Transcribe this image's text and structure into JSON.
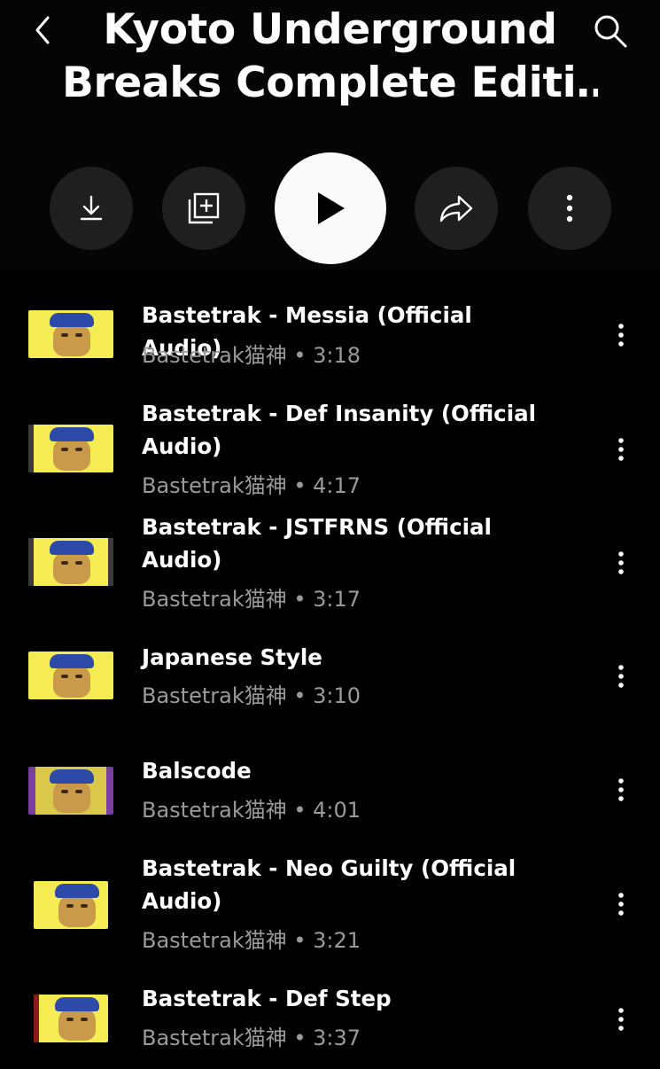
{
  "header": {
    "title_line1": "Kyoto Underground",
    "title_line2": "Breaks Complete Editi…"
  },
  "actions": {
    "download_icon": "download-icon",
    "add_icon": "add-to-playlist-icon",
    "play_icon": "play-icon",
    "share_icon": "share-icon",
    "more_icon": "more-vertical-icon"
  },
  "tracks": [
    {
      "title": "Bastetrak - Messia (Official Audio)",
      "artist": "Bastetrak猫神",
      "duration": "3:18",
      "meta": "Bastetrak猫神 • 3:18",
      "thumb_label": "Messia"
    },
    {
      "title": "Bastetrak - Def Insanity (Official Audio)",
      "artist": "Bastetrak猫神",
      "duration": "4:17",
      "meta": "Bastetrak猫神 • 4:17",
      "thumb_label": "Def Insanity"
    },
    {
      "title": "Bastetrak - JSTFRNS (Official Audio)",
      "artist": "Bastetrak猫神",
      "duration": "3:17",
      "meta": "Bastetrak猫神 • 3:17",
      "thumb_label": "JSTFRNS"
    },
    {
      "title": "Japanese Style",
      "artist": "Bastetrak猫神",
      "duration": "3:10",
      "meta": "Bastetrak猫神 • 3:10",
      "thumb_label": "Japanese Style"
    },
    {
      "title": "Balscode",
      "artist": "Bastetrak猫神",
      "duration": "4:01",
      "meta": "Bastetrak猫神 • 4:01",
      "thumb_label": "Balscode"
    },
    {
      "title": "Bastetrak - Neo Guilty (Official Audio)",
      "artist": "Bastetrak猫神",
      "duration": "3:21",
      "meta": "Bastetrak猫神 • 3:21",
      "thumb_label": "Neo Guilty"
    },
    {
      "title": "Bastetrak - Def Step",
      "artist": "Bastetrak猫神",
      "duration": "3:37",
      "meta": "Bastetrak猫神 • 3:37",
      "thumb_label": "def step"
    }
  ]
}
